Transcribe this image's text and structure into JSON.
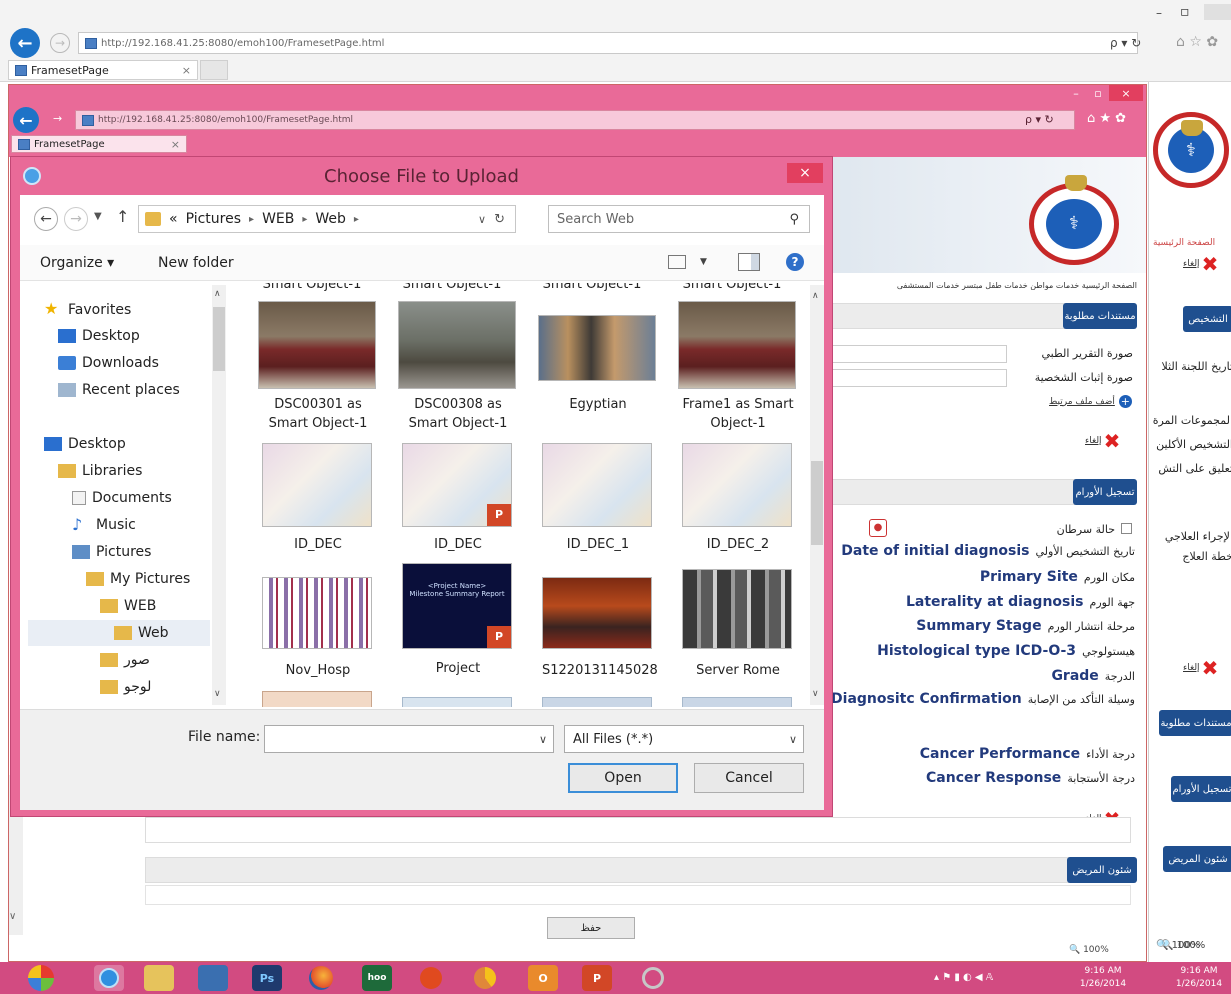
{
  "outer_browser": {
    "url": "http://192.168.41.25:8080/emoh100/FramesetPage.html",
    "tab_title": "FramesetPage",
    "tab_close": "×",
    "search_refresh": "ρ ▾ ↻",
    "win_minimize": "–",
    "win_maximize": "▫",
    "zoom": "🔍 100%"
  },
  "inner_browser": {
    "url": "http://192.168.41.25:8080/emoh100/FramesetPage.html",
    "tab_title": "FramesetPage",
    "tab_close": "×",
    "win_minimize": "–",
    "win_maximize": "▫",
    "win_close": "×",
    "nav_icons": "ρ ▾ ↻",
    "home_star_gear": "⌂ ★ ✿",
    "zoom": "🔍 100%",
    "save_button": "حفظ"
  },
  "page": {
    "breadcrumb": "الصفحة الرئيسية   خدمات مواطن   خدمات طفل مبتسر   خدمات المستشفى",
    "tab_docs": "مستندات مطلوبة",
    "doc_items": [
      "صورة التقرير الطبي",
      "صورة إثبات الشخصية"
    ],
    "add_attachment": "أضف ملف مرتبط",
    "delete_label": "إلغاء",
    "tab_tumor": "تسجيل الأورام",
    "cancer_case": "حالة سرطان",
    "form_rows": [
      {
        "en": "Date of initial diagnosis",
        "ar": "تاريخ التشخيص الأولي"
      },
      {
        "en": "Primary Site",
        "ar": "مكان الورم"
      },
      {
        "en": "Laterality at diagnosis",
        "ar": "جهة الورم"
      },
      {
        "en": "Summary Stage",
        "ar": "مرحلة انتشار الورم"
      },
      {
        "en": "Histological type ICD-O-3",
        "ar": "هيستولوجي"
      },
      {
        "en": "Grade",
        "ar": "الدرجة"
      },
      {
        "en": "Diagnositc Confirmation",
        "ar": "وسيلة التأكد من الإصابة"
      }
    ],
    "form_rows_2": [
      {
        "en": "Cancer Performance",
        "ar": "درجة الأداء"
      },
      {
        "en": "Cancer Response",
        "ar": "درجة الأستجابة"
      }
    ],
    "tab_patient": "شئون المريض"
  },
  "right_page": {
    "breadcrumb": "الصفحة الرئيسية",
    "delete_label": "إلغاء",
    "tab_diagnosis": "التشخيص",
    "lines": [
      "تاريخ اللجنة الثلا",
      "المجموعات المرة",
      "التشخيص الأكلين",
      "تعليق على التش",
      "الإجراء العلاجي",
      "خطة العلاج"
    ],
    "tab_docs": "مستندات مطلوبة",
    "tab_tumor": "تسجيل الأورام",
    "tab_patient": "شئون المريض",
    "zoom": "🔍 100%"
  },
  "dialog": {
    "title": "Choose File to Upload",
    "close": "×",
    "breadcrumb": [
      "«",
      "Pictures",
      "WEB",
      "Web"
    ],
    "search_placeholder": "Search Web",
    "organize": "Organize ▾",
    "new_folder": "New folder",
    "nav": {
      "favorites": "Favorites",
      "favorite_items": [
        "Desktop",
        "Downloads",
        "Recent places"
      ],
      "desktop": "Desktop",
      "libraries": "Libraries",
      "library_items": [
        "Documents",
        "Music",
        "Pictures"
      ],
      "my_pictures": "My Pictures",
      "web_upper": "WEB",
      "web": "Web",
      "folder_arabic_1": "صور",
      "folder_arabic_2": "لوجو"
    },
    "partial_top_captions": [
      "Smart Object-1",
      "Smart Object-1",
      "Smart Object-1",
      "Smart Object-1"
    ],
    "files": [
      {
        "name": "DSC00301 as\nSmart Object-1"
      },
      {
        "name": "DSC00308 as\nSmart Object-1"
      },
      {
        "name": "Egyptian"
      },
      {
        "name": "Frame1 as Smart\nObject-1"
      },
      {
        "name": "ID_DEC"
      },
      {
        "name": "ID_DEC"
      },
      {
        "name": "ID_DEC_1"
      },
      {
        "name": "ID_DEC_2"
      },
      {
        "name": "Nov_Hosp"
      },
      {
        "name": "Project"
      },
      {
        "name": "S1220131145028"
      },
      {
        "name": "Server Rome"
      }
    ],
    "project_slide_text": "<Project Name>\nMilestone Summary Report",
    "file_name_label": "File name:",
    "file_name_value": "",
    "file_type": "All Files (*.*)",
    "open": "Open",
    "cancel": "Cancel"
  },
  "taskbar": {
    "icons": [
      "start-icon",
      "ie-icon",
      "explorer-icon",
      "network-icon",
      "photoshop-icon",
      "firefox-icon",
      "hoo-icon",
      "media-icon",
      "chrome-like-icon",
      "outlook-icon",
      "powerpoint-icon",
      "tools-icon"
    ],
    "ps_label": "Ps",
    "hoo_label": "hoo",
    "o_label": "O",
    "p_label": "P",
    "time_1": "9:16 AM",
    "date_1": "1/26/2014",
    "time_2": "9:16 AM",
    "date_2": "1/26/2014"
  }
}
